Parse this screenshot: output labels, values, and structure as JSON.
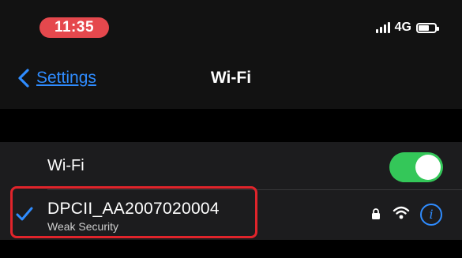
{
  "status_bar": {
    "time": "11:35",
    "network": "4G",
    "signal_bars": 4,
    "battery_level": 0.7
  },
  "nav": {
    "back_label": "Settings",
    "title": "Wi-Fi"
  },
  "wifi_toggle": {
    "label": "Wi-Fi",
    "on": true
  },
  "network": {
    "name": "DPCII_AA2007020004",
    "subtitle": "Weak Security",
    "info_glyph": "i"
  },
  "colors": {
    "accent": "#2f8cff",
    "toggle_on": "#34c759",
    "time_pill": "#e5484d",
    "highlight": "#e0242b"
  }
}
